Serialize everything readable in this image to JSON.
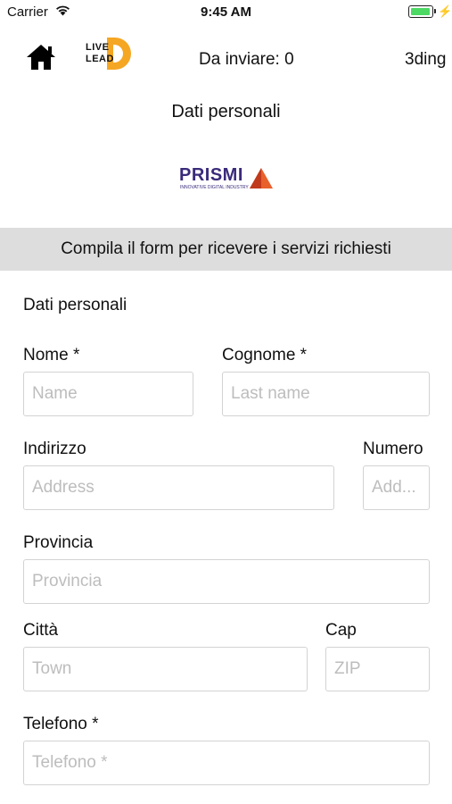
{
  "status_bar": {
    "carrier": "Carrier",
    "time": "9:45 AM"
  },
  "nav": {
    "queue_label": "Da inviare: 0",
    "brand": "3ding"
  },
  "logo": {
    "line1": "LIVE",
    "line2": "LEAD",
    "letter": "D"
  },
  "page_title": "Dati personali",
  "partner_logo": {
    "name": "PRISMI",
    "tagline": "INNOVATIVE DIGITAL INDUSTRY"
  },
  "banner": "Compila il form per ricevere i servizi richiesti",
  "form": {
    "section_title": "Dati personali",
    "nome": {
      "label": "Nome *",
      "placeholder": "Name"
    },
    "cognome": {
      "label": "Cognome *",
      "placeholder": "Last name"
    },
    "indirizzo": {
      "label": "Indirizzo",
      "placeholder": "Address"
    },
    "numero": {
      "label": "Numero",
      "placeholder": "Add..."
    },
    "provincia": {
      "label": "Provincia",
      "placeholder": "Provincia"
    },
    "citta": {
      "label": "Città",
      "placeholder": "Town"
    },
    "cap": {
      "label": "Cap",
      "placeholder": "ZIP"
    },
    "telefono": {
      "label": "Telefono *",
      "placeholder": "Telefono *"
    }
  },
  "colors": {
    "logo_orange": "#f5a623",
    "prismi_purple": "#3a2a7a",
    "prismi_orange": "#e8602c",
    "banner_bg": "#dddddd",
    "battery_green": "#4cd964"
  }
}
